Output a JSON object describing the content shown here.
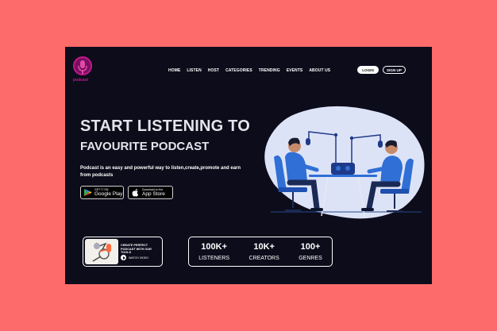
{
  "brand": {
    "name": "podcast",
    "accent": "#c2188a"
  },
  "nav": {
    "items": [
      "HOME",
      "LISTEN",
      "HOST",
      "CATEGORIES",
      "TRENDING",
      "EVENTS",
      "ABOUT US"
    ]
  },
  "auth": {
    "login": "LOGIN",
    "signup": "SIGN UP"
  },
  "hero": {
    "title_line1": "START LISTENING TO",
    "title_line2": "FAVOURITE PODCAST",
    "description": "Podcast is an easy and powerful way to listen,create,promote and earn from podcasts"
  },
  "stores": {
    "google": {
      "small": "GET IT ON",
      "large": "Google Play"
    },
    "apple": {
      "small": "Download on the",
      "large": "App Store"
    }
  },
  "promo": {
    "title": "CREATE PERFECT PODCAST WITH OUR TOOLS",
    "watch": "WATCH VIDEO"
  },
  "stats": [
    {
      "value": "100K+",
      "label": "LISTENERS"
    },
    {
      "value": "10K+",
      "label": "CREATORS"
    },
    {
      "value": "100+",
      "label": "GENRES"
    }
  ],
  "colors": {
    "page_bg": "#fd6b6b",
    "frame_bg": "#0c0c1b",
    "illustration_bg": "#dde3f7",
    "figure_blue": "#2f6fd6"
  }
}
